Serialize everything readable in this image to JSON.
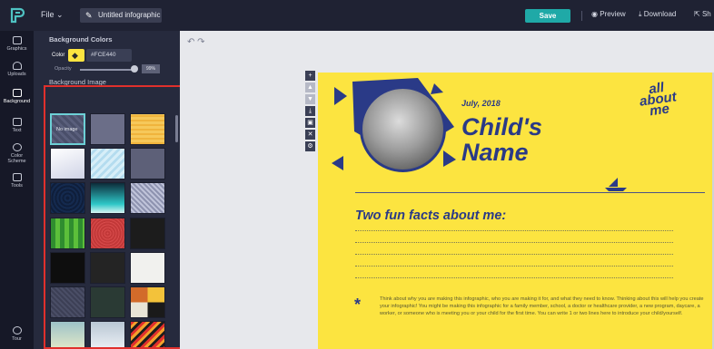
{
  "app": {
    "file_menu": "File ⌄",
    "document_title": "Untitled infographic",
    "save_label": "Save",
    "preview_label": "Preview",
    "download_label": "Download",
    "share_label": "Sh"
  },
  "rail": {
    "items": [
      {
        "label": "Graphics",
        "icon": "graphics-icon"
      },
      {
        "label": "Uploads",
        "icon": "cloud-upload-icon"
      },
      {
        "label": "Background",
        "icon": "background-icon"
      },
      {
        "label": "Text",
        "icon": "text-icon"
      },
      {
        "label": "Color Scheme",
        "icon": "palette-icon"
      },
      {
        "label": "Tools",
        "icon": "toolbox-icon"
      },
      {
        "label": "Tour",
        "icon": "tour-icon"
      }
    ],
    "active": "Background"
  },
  "panel": {
    "bg_colors_heading": "Background Colors",
    "color_label": "Color",
    "color_value": "#FCE440",
    "bg_image_heading": "Background Image",
    "opacity_label": "Opacity",
    "opacity_value": "99%",
    "no_image_label": "No image"
  },
  "canvas": {
    "date": "July, 2018",
    "name_line1": "Child's",
    "name_line2": "Name",
    "stamp_line1": "all",
    "stamp_line2": "about",
    "stamp_line3": "me",
    "headline": "Two fun facts about me:",
    "intro_text": "Think about why you are making this infographic, who you are making it for, and what they need to know. Thinking about this will help you create your infographic! You might be making this infographic for a family member, school, a doctor or healthcare provider, a new program, daycare, a worker, or someone who is meeting you or your child for the first time. You can write 1 or two lines here to introduce your child/yourself."
  },
  "colors": {
    "accent": "#1fa9a7",
    "canvas_bg": "#fce440",
    "ink": "#2a3a87",
    "highlight": "#e0302c"
  }
}
